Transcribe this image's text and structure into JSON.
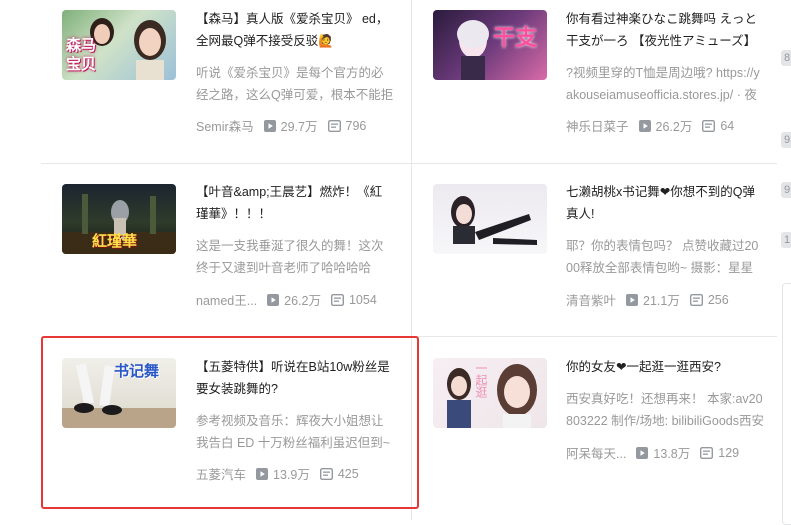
{
  "cards": [
    {
      "title": "【森马】真人版《爱杀宝贝》 ed，全网最Q弹不接受反驳🙋",
      "description": "听说《爱杀宝贝》是每个官方的必经之路，这么Q弹可爱，根本不能拒",
      "author": "Semir森马",
      "plays": "29.7万",
      "comments": "796",
      "thumb_text": "森马\n宝贝"
    },
    {
      "title": "你有看过神楽ひなこ跳舞吗 えっと干支が一ろ 【夜光性アミューズ】【神",
      "description": "?视频里穿的T恤是周边哦? https://yakouseiamuseofficia.stores.jp/ · 夜光",
      "author": "神乐日菜子",
      "plays": "26.2万",
      "comments": "64",
      "thumb_text": "干支"
    },
    {
      "title": "【叶音&amp;王晨艺】燃炸！《紅瑾華》！！！",
      "description": "这是一支我垂涎了很久的舞！这次终于又逮到叶音老师了哈哈哈哈哈！感",
      "author": "named王...",
      "plays": "26.2万",
      "comments": "1054",
      "thumb_text": "紅瑾華"
    },
    {
      "title": "七濑胡桃x书记舞❤你想不到的Q弹真人!",
      "description": "耶？你的表情包吗？ 点赞收藏过2000释放全部表情包哟~ 摄影：星星",
      "author": "清音紫叶",
      "plays": "21.1万",
      "comments": "256",
      "thumb_text": ""
    },
    {
      "title": "【五菱特供】听说在B站10w粉丝是要女装跳舞的?",
      "description": "参考视频及音乐：辉夜大小姐想让我告白 ED 十万粉丝福利虽迟但到~",
      "author": "五菱汽车",
      "plays": "13.9万",
      "comments": "425",
      "thumb_text": "书记舞"
    },
    {
      "title": "你的女友❤一起逛一逛西安?",
      "description": "西安真好吃！还想再来！ 本家:av20803222 制作/场地: bilibiliGoods西安",
      "author": "阿呆每天...",
      "plays": "13.8万",
      "comments": "129",
      "thumb_text": "一起逛"
    }
  ],
  "side_chips": [
    "8",
    "9",
    "9",
    "1"
  ],
  "colors": {
    "highlight_border": "#e53935",
    "meta_text": "#999999",
    "divider": "#e7e7e7"
  }
}
